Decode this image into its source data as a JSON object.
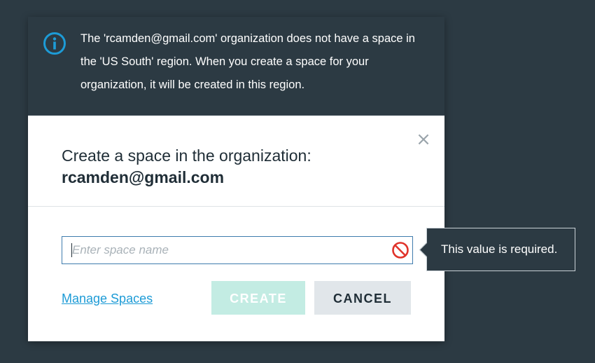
{
  "notice": {
    "icon": "info-icon",
    "text": "The 'rcamden@gmail.com' organization does not have a space in the 'US South' region. When you create a space for your organization, it will be created in this region."
  },
  "dialog": {
    "title": "Create a space in the organization:",
    "org_name": "rcamden@gmail.com",
    "close_icon": "close-icon",
    "space_name_input": {
      "value": "",
      "placeholder": "Enter space name"
    },
    "error_icon": "error-icon",
    "manage_link_label": "Manage Spaces",
    "create_label": "CREATE",
    "cancel_label": "CANCEL"
  },
  "tooltip": {
    "text": "This value is required."
  },
  "colors": {
    "background": "#2c3a43",
    "accent": "#1d9bd6",
    "create_disabled": "#c3ece3",
    "cancel": "#e1e6ea",
    "error": "#e0332a"
  }
}
